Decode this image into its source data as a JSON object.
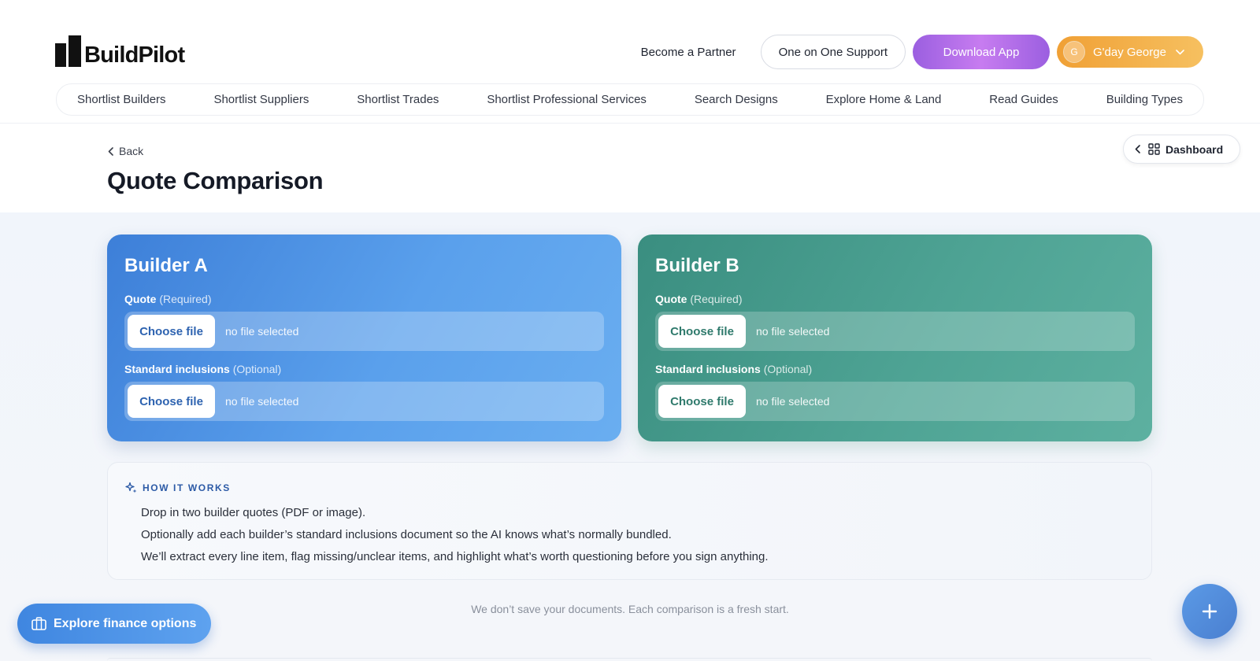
{
  "header": {
    "logo_text": "BuildPilot",
    "partner_link": "Become a Partner",
    "support_button": "One on One Support",
    "download_button": "Download App",
    "user": {
      "initial": "G",
      "name": "G'day George"
    }
  },
  "nav": {
    "items": [
      "Shortlist Builders",
      "Shortlist Suppliers",
      "Shortlist Trades",
      "Shortlist Professional Services",
      "Search Designs",
      "Explore Home & Land",
      "Read Guides",
      "Building Types"
    ]
  },
  "page": {
    "back_label": "Back",
    "title": "Quote Comparison",
    "dashboard_button": "Dashboard"
  },
  "builders": [
    {
      "title": "Builder A",
      "quote_label": "Quote",
      "quote_hint": "(Required)",
      "inclusions_label": "Standard inclusions",
      "inclusions_hint": "(Optional)",
      "choose_label": "Choose file",
      "no_file": "no file selected"
    },
    {
      "title": "Builder B",
      "quote_label": "Quote",
      "quote_hint": "(Required)",
      "inclusions_label": "Standard inclusions",
      "inclusions_hint": "(Optional)",
      "choose_label": "Choose file",
      "no_file": "no file selected"
    }
  ],
  "how_it_works": {
    "heading": "HOW IT WORKS",
    "lines": [
      "Drop in two builder quotes (PDF or image).",
      "Optionally add each builder’s standard inclusions document so the AI knows what’s normally bundled.",
      "We’ll extract every line item, flag missing/unclear items, and highlight what’s worth questioning before you sign anything."
    ]
  },
  "disclaimer": "We don’t save your documents. Each comparison is a fresh start.",
  "finance_button": "Explore finance options",
  "colors": {
    "builder_a": "#4a8fe4",
    "builder_b": "#44998a",
    "download": "#b06ee8",
    "user": "#f2ab45",
    "accent": "#2c5aa6"
  },
  "icons": {
    "back": "chevron-left-icon",
    "dashboard": "grid-icon",
    "user_menu": "chevron-down-icon",
    "how": "sparkle-icon",
    "finance": "briefcase-icon",
    "fab": "plus-icon"
  }
}
